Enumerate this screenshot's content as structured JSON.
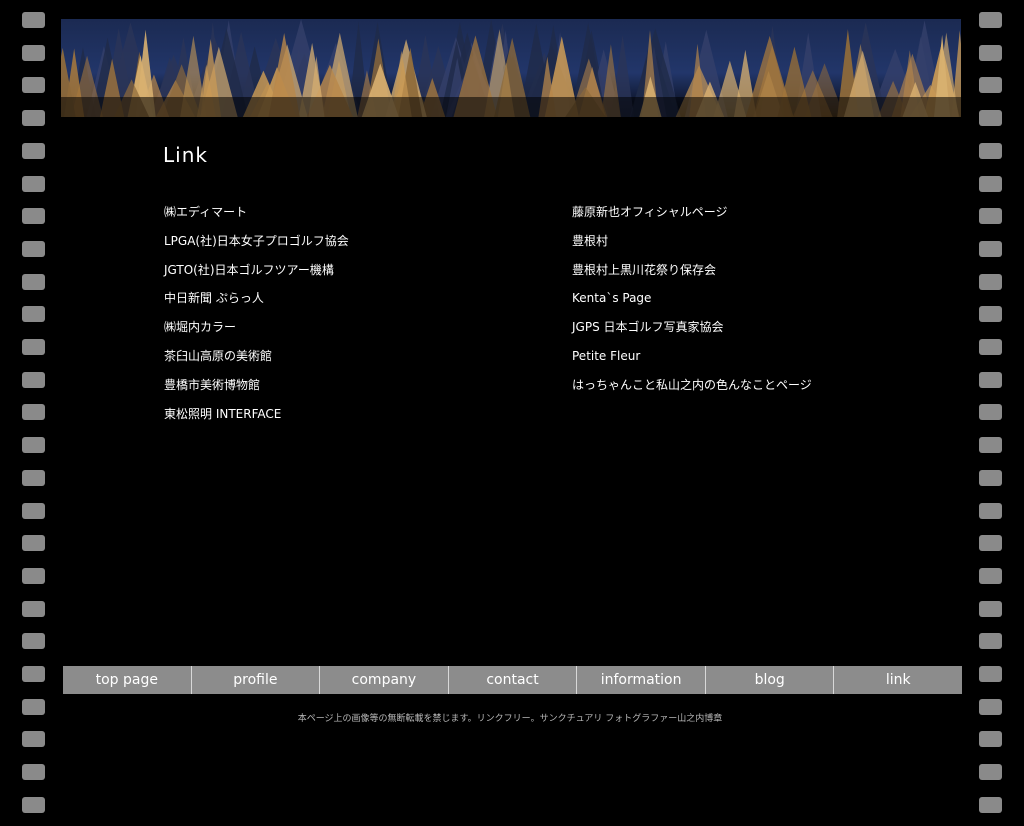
{
  "page": {
    "title": "Link"
  },
  "links": {
    "left": [
      "㈱エディマート",
      "LPGA(社)日本女子プロゴルフ協会",
      "JGTO(社)日本ゴルフツアー機構",
      "中日新聞 ぷらっ人",
      "㈱堀内カラー",
      "茶臼山高原の美術館",
      "豊橋市美術博物館",
      "東松照明 INTERFACE"
    ],
    "right": [
      "藤原新也オフィシャルページ",
      "豊根村",
      "豊根村上黒川花祭り保存会",
      "Kenta`s Page",
      "JGPS 日本ゴルフ写真家協会",
      "Petite Fleur",
      "はっちゃんこと私山之内の色んなことページ"
    ]
  },
  "nav": {
    "items": [
      "top page",
      "profile",
      "company",
      "contact",
      "information",
      "blog",
      "link"
    ]
  },
  "footer": {
    "note": "本ページ上の画像等の無断転載を禁じます。リンクフリー。サンクチュアリ フォトグラファー山之内博章"
  },
  "colors": {
    "background": "#000000",
    "nav_bar": "#8c8c8c",
    "sprocket": "#8a8a8a",
    "text": "#ffffff"
  }
}
